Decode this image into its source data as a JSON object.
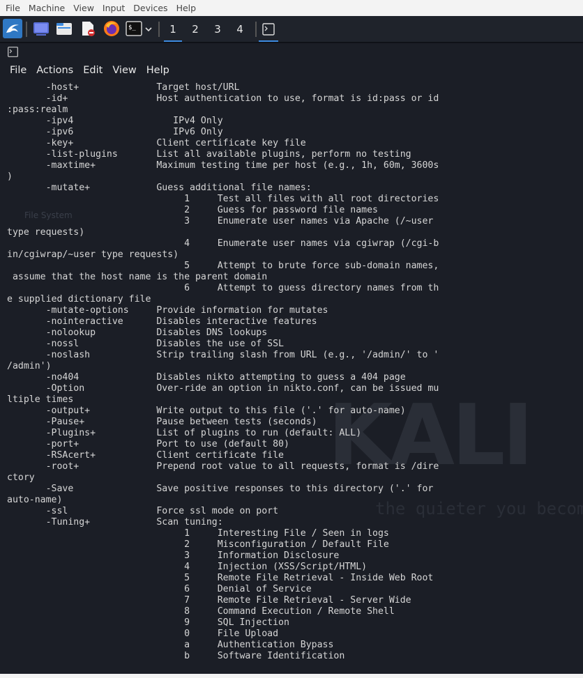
{
  "host_menu": [
    "File",
    "Machine",
    "View",
    "Input",
    "Devices",
    "Help"
  ],
  "panel": {
    "workspaces": [
      "1",
      "2",
      "3",
      "4"
    ],
    "active_workspace": "1",
    "icons": [
      "kali-menu-icon",
      "desktop-icon",
      "file-manager-icon",
      "text-editor-icon",
      "firefox-icon",
      "terminal-icon",
      "chevron-down-icon",
      "terminal-window-icon"
    ]
  },
  "terminal": {
    "menu": [
      "File",
      "Actions",
      "Edit",
      "View",
      "Help"
    ],
    "watermark": "KALI",
    "watermark_tagline": "the quieter you become",
    "ghost_label": "File System",
    "lines": [
      "       -host+              Target host/URL",
      "       -id+                Host authentication to use, format is id:pass or id",
      ":pass:realm",
      "       -ipv4                  IPv4 Only",
      "       -ipv6                  IPv6 Only",
      "       -key+               Client certificate key file",
      "       -list-plugins       List all available plugins, perform no testing",
      "       -maxtime+           Maximum testing time per host (e.g., 1h, 60m, 3600s",
      ")",
      "       -mutate+            Guess additional file names:",
      "                                1     Test all files with all root directories",
      "                                2     Guess for password file names",
      "                                3     Enumerate user names via Apache (/~user",
      "type requests)",
      "                                4     Enumerate user names via cgiwrap (/cgi-b",
      "in/cgiwrap/~user type requests)",
      "                                5     Attempt to brute force sub-domain names,",
      " assume that the host name is the parent domain",
      "                                6     Attempt to guess directory names from th",
      "e supplied dictionary file",
      "       -mutate-options     Provide information for mutates",
      "       -nointeractive      Disables interactive features",
      "       -nolookup           Disables DNS lookups",
      "       -nossl              Disables the use of SSL",
      "       -noslash            Strip trailing slash from URL (e.g., '/admin/' to '",
      "/admin')",
      "       -no404              Disables nikto attempting to guess a 404 page",
      "       -Option             Over-ride an option in nikto.conf, can be issued mu",
      "ltiple times",
      "       -output+            Write output to this file ('.' for auto-name)",
      "       -Pause+             Pause between tests (seconds)",
      "       -Plugins+           List of plugins to run (default: ALL)",
      "       -port+              Port to use (default 80)",
      "       -RSAcert+           Client certificate file",
      "       -root+              Prepend root value to all requests, format is /dire",
      "ctory",
      "       -Save               Save positive responses to this directory ('.' for",
      "auto-name)",
      "       -ssl                Force ssl mode on port",
      "       -Tuning+            Scan tuning:",
      "                                1     Interesting File / Seen in logs",
      "                                2     Misconfiguration / Default File",
      "                                3     Information Disclosure",
      "                                4     Injection (XSS/Script/HTML)",
      "                                5     Remote File Retrieval - Inside Web Root",
      "                                6     Denial of Service",
      "                                7     Remote File Retrieval - Server Wide",
      "                                8     Command Execution / Remote Shell",
      "                                9     SQL Injection",
      "                                0     File Upload",
      "                                a     Authentication Bypass",
      "                                b     Software Identification"
    ]
  }
}
